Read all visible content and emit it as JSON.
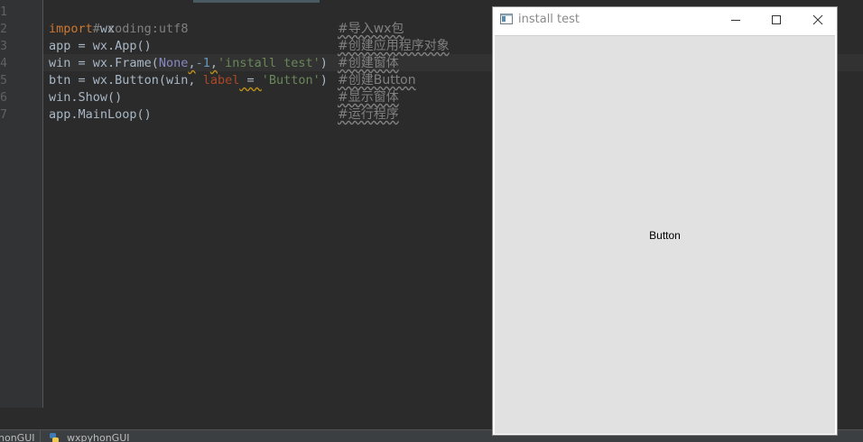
{
  "editor": {
    "line_numbers": [
      "1",
      "2",
      "3",
      "4",
      "5",
      "6",
      "7"
    ],
    "lines": {
      "l1": {
        "comment": "# coding:utf8"
      },
      "l2": {
        "kw": "import",
        "rest": " wx",
        "zh": "#导入wx包"
      },
      "l3": {
        "code": "app = wx.App()",
        "zh": "#创建应用程序对象"
      },
      "l4": {
        "a": "win = wx.Frame(",
        "none": "None",
        "comma1": ",",
        "neg": "-1",
        "comma2": ",",
        "str": "'install test'",
        "close": ")",
        "zh": "#创建窗体"
      },
      "l5": {
        "a": "btn = wx.Button(win, ",
        "kwarg": "label",
        "eq": " = ",
        "str": "'Button'",
        "close": ")",
        "zh": "#创建Button"
      },
      "l6": {
        "code": "win.Show()",
        "zh": "#显示窗体"
      },
      "l7": {
        "code": "app.MainLoop()",
        "zh": "#运行程序"
      }
    }
  },
  "bottom_tabs": {
    "tab1": "honGUI",
    "tab2": "wxpyhonGUI"
  },
  "wx_window": {
    "title": "install test",
    "button_label": "Button",
    "icons": {
      "app": "app-window-icon",
      "minimize": "minimize-icon",
      "maximize": "maximize-icon",
      "close": "close-icon"
    }
  },
  "colors": {
    "editor_bg": "#2b2b2b",
    "keyword": "#cc7832",
    "string": "#6a8759",
    "comment": "#808080",
    "number": "#6897bb",
    "builtin": "#8888c6",
    "window_client": "#e1e1e1"
  }
}
